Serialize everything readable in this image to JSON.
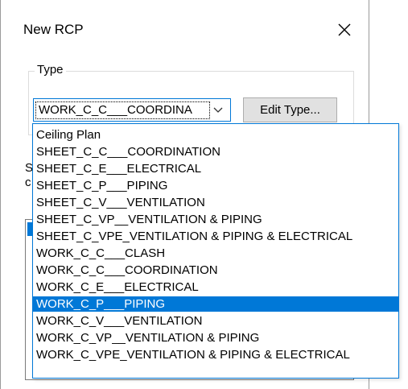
{
  "dialog": {
    "title": "New RCP",
    "close_icon": "close-icon"
  },
  "type_group": {
    "label": "Type",
    "selected_value": "WORK_C_C___COORDINA",
    "edit_type_label": "Edit Type..."
  },
  "hidden_labels": {
    "s_fragment": "S",
    "c_fragment": "c"
  },
  "dropdown": {
    "items": [
      "Ceiling Plan",
      "SHEET_C_C___COORDINATION",
      "SHEET_C_E___ELECTRICAL",
      "SHEET_C_P___PIPING",
      "SHEET_C_V___VENTILATION",
      "SHEET_C_VP__VENTILATION & PIPING",
      "SHEET_C_VPE_VENTILATION & PIPING & ELECTRICAL",
      "WORK_C_C___CLASH",
      "WORK_C_C___COORDINATION",
      "WORK_C_E___ELECTRICAL",
      "WORK_C_P___PIPING",
      "WORK_C_V___VENTILATION",
      "WORK_C_VP__VENTILATION & PIPING",
      "WORK_C_VPE_VENTILATION & PIPING & ELECTRICAL"
    ],
    "highlighted_index": 10,
    "colors": {
      "accent": "#0078d7",
      "button_face": "#e1e1e1"
    }
  }
}
